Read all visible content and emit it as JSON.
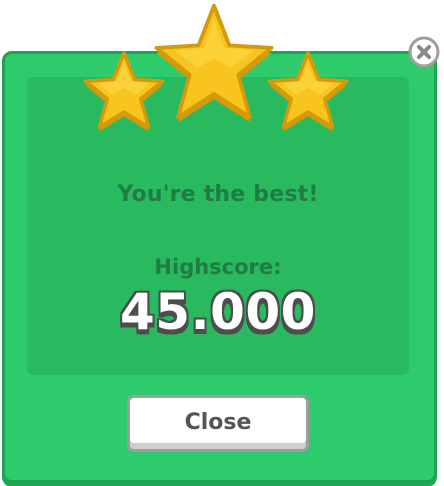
{
  "dialog": {
    "message": "You're the best!",
    "highscore_label": "Highscore:",
    "highscore_value": "45.000",
    "close_button_label": "Close",
    "stars_earned": 3,
    "stars_total": 3
  },
  "icons": {
    "stars": [
      "star-icon",
      "star-icon",
      "star-icon"
    ],
    "close": "close-icon"
  },
  "colors": {
    "panel": "#2ecb6c",
    "panel_inner": "#29b95e",
    "text_dark_green": "#1f7c45",
    "star_fill": "#f7c51d",
    "star_border": "#d49a0a"
  }
}
